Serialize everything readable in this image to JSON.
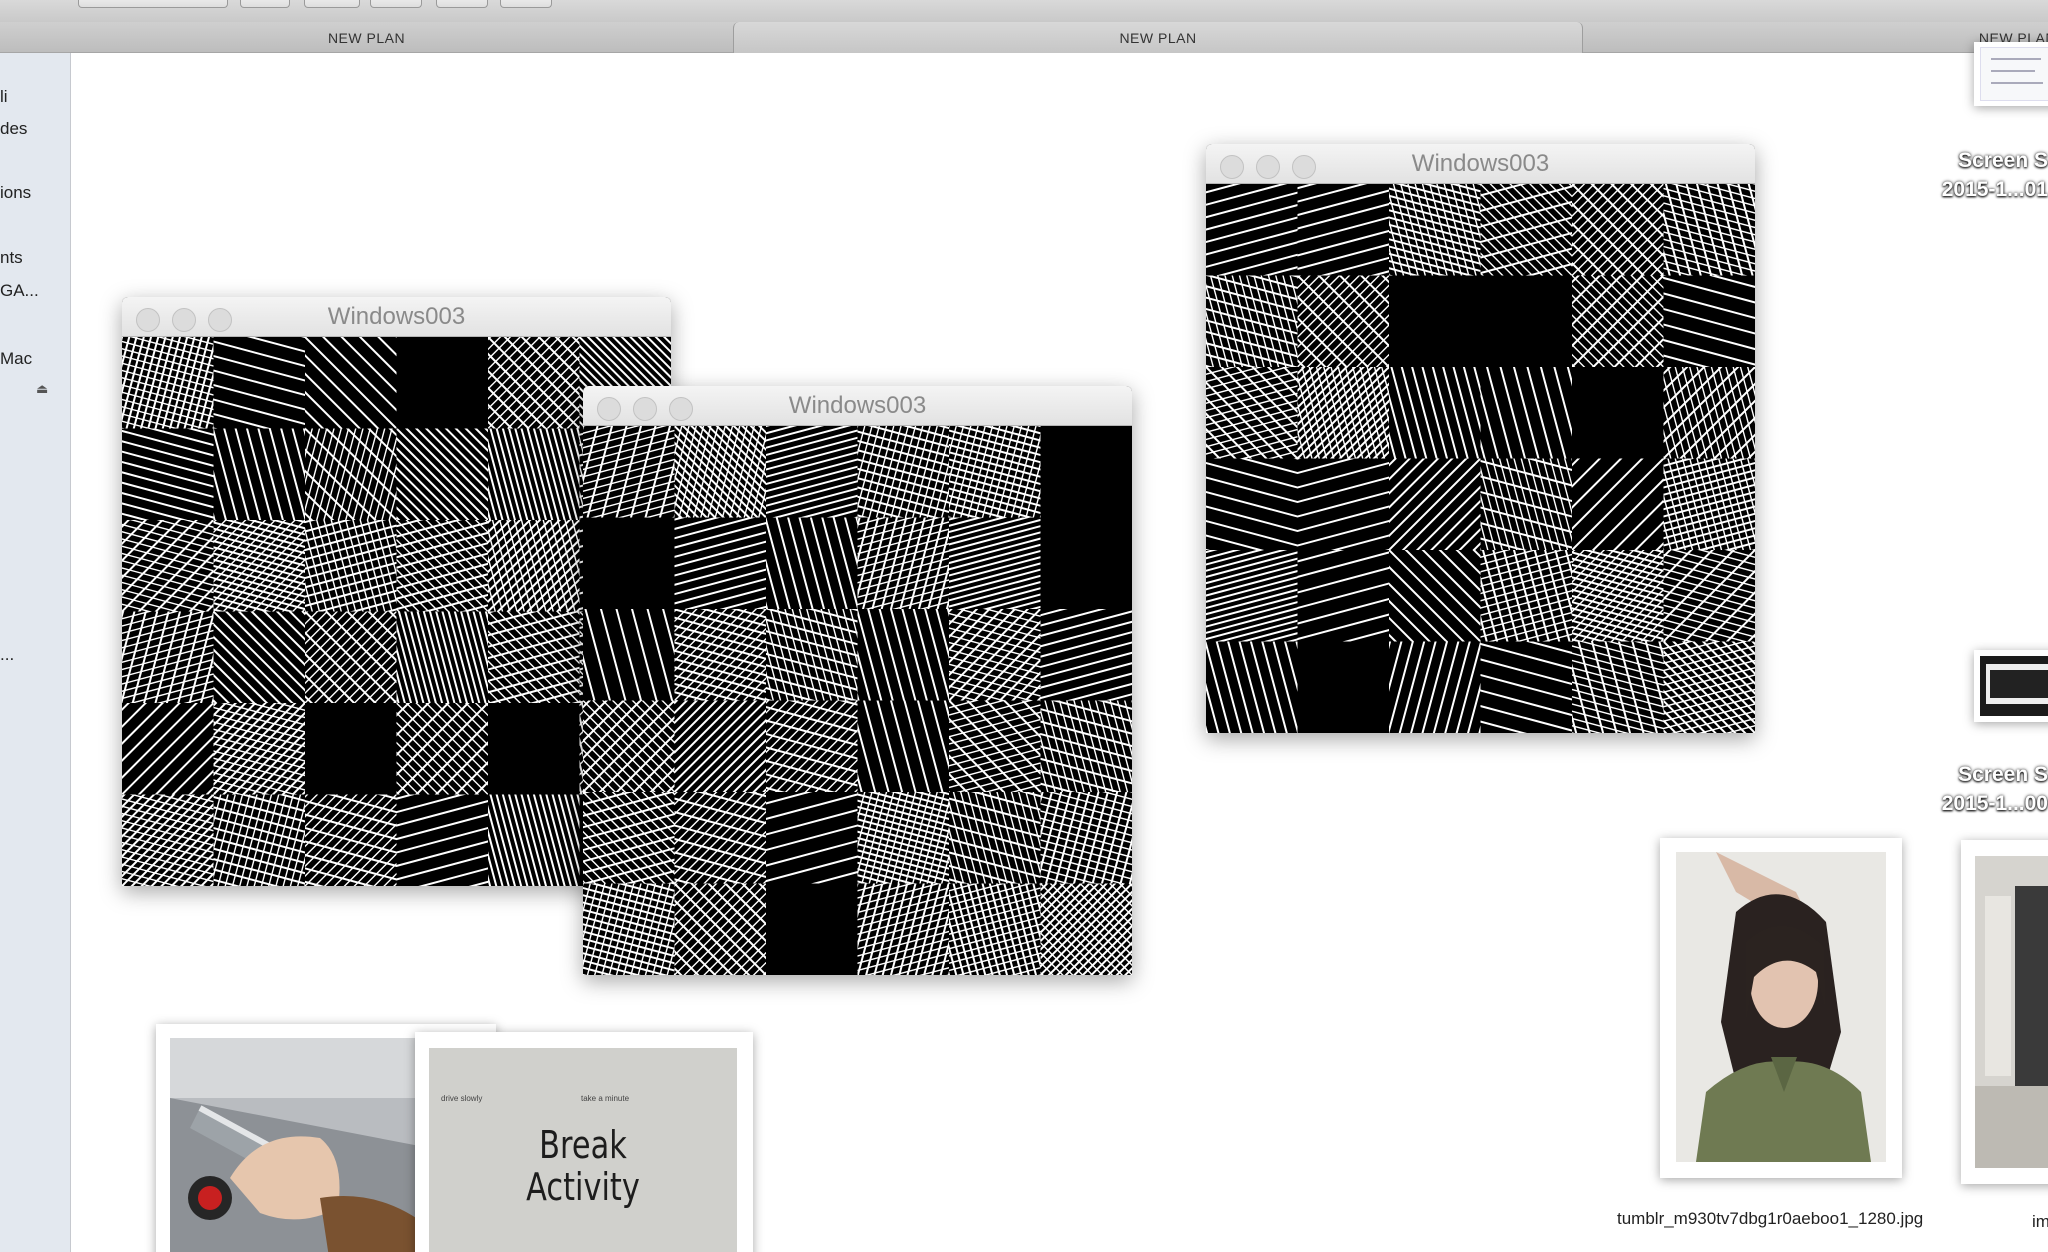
{
  "tabs": [
    {
      "label": "NEW PLAN"
    },
    {
      "label": "NEW PLAN"
    },
    {
      "label": "NEW PLAN"
    }
  ],
  "sidebar": {
    "items": [
      "li",
      "des",
      "ions",
      "nts",
      "GA...",
      "Mac",
      "..."
    ]
  },
  "windows": [
    {
      "title": "Windows003"
    },
    {
      "title": "Windows003"
    },
    {
      "title": "Windows003"
    }
  ],
  "desktop": {
    "screen_labels": [
      {
        "line1": "Screen S",
        "line2": "2015-1...01"
      },
      {
        "line1": "Screen S",
        "line2": "2015-1...00"
      }
    ],
    "file_captions": [
      "tumblr_m930tv7dbg1r0aeboo1_1280.jpg",
      "im"
    ]
  },
  "photo_text": {
    "break_activity": "Break Activity",
    "small_left": "drive slowly",
    "small_right": "take a minute"
  },
  "colors": {
    "sidebar_bg": "#e3e8ef",
    "tabbar_bg": "#c6c6c6",
    "window_titlebar": "#ebebeb",
    "pattern_fg": "#ffffff",
    "pattern_bg": "#000000"
  },
  "icons": [
    "eject-icon",
    "close-light-icon",
    "minimize-light-icon",
    "zoom-light-icon"
  ]
}
